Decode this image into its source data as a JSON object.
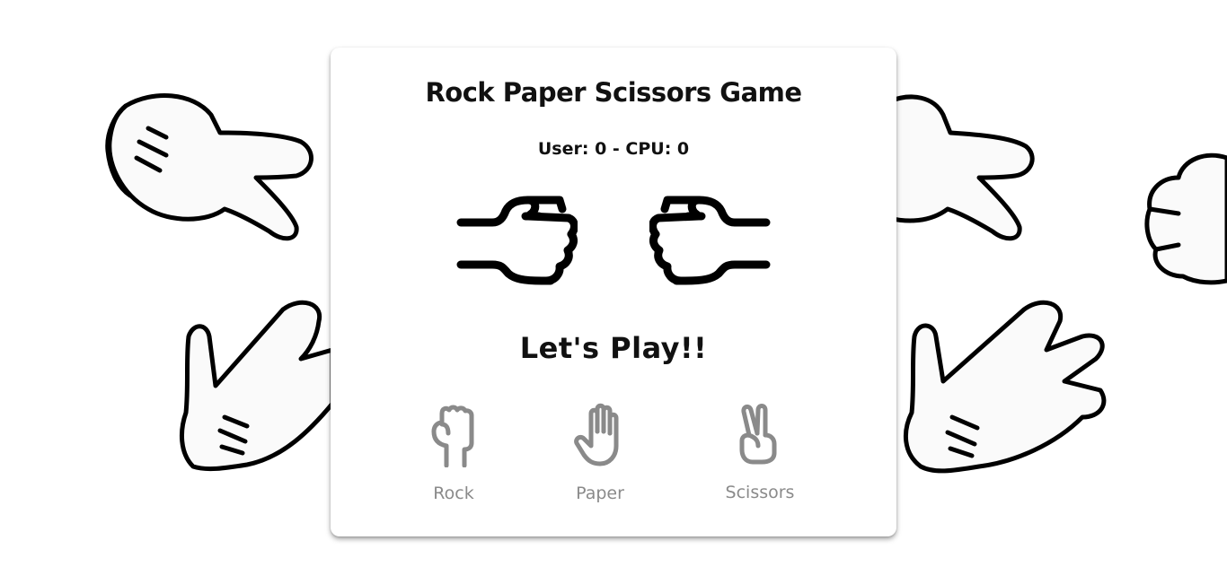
{
  "game": {
    "title": "Rock Paper Scissors Game",
    "score_text": "User: 0 - CPU: 0",
    "status": "Let's Play!!",
    "user_hand_icon": "fist-right-icon",
    "cpu_hand_icon": "fist-left-icon"
  },
  "choices": [
    {
      "label": "Rock",
      "icon": "rock-icon"
    },
    {
      "label": "Paper",
      "icon": "paper-icon"
    },
    {
      "label": "Scissors",
      "icon": "scissors-icon"
    }
  ],
  "colors": {
    "background": "#ffffff",
    "card": "#ffffff",
    "text": "#111111",
    "choice_gray": "#8a8a8a",
    "glove_fill": "#fafafa",
    "outline": "#000000"
  }
}
